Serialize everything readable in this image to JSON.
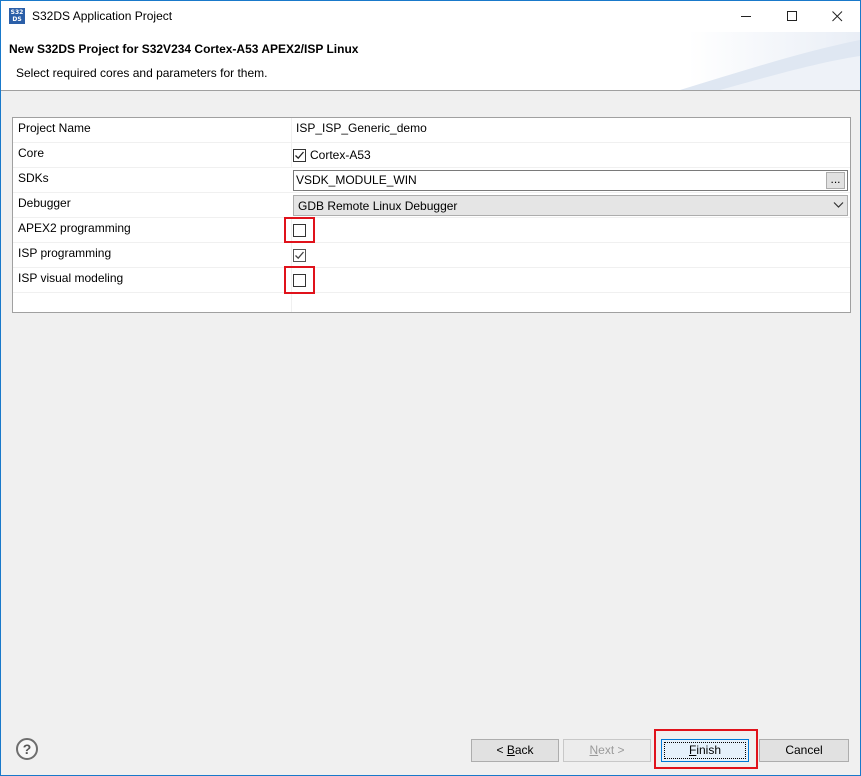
{
  "window": {
    "title": "S32DS Application Project",
    "app_icon_text_top": "S32",
    "app_icon_text_bottom": "DS"
  },
  "banner": {
    "title": "New S32DS Project for S32V234 Cortex-A53 APEX2/ISP Linux",
    "description": "Select required cores and parameters for them."
  },
  "properties": {
    "project_name": {
      "label": "Project Name",
      "value": "ISP_ISP_Generic_demo"
    },
    "core": {
      "label": "Core",
      "option_label": "Cortex-A53",
      "checked": true
    },
    "sdks": {
      "label": "SDKs",
      "value": "VSDK_MODULE_WIN",
      "browse_label": "..."
    },
    "debugger": {
      "label": "Debugger",
      "selected": "GDB Remote Linux Debugger"
    },
    "apex2": {
      "label": "APEX2 programming",
      "checked": false
    },
    "isp": {
      "label": "ISP programming",
      "checked": true
    },
    "isp_visual": {
      "label": "ISP visual modeling",
      "checked": false
    }
  },
  "buttons": {
    "help": "?",
    "back_prefix": "< ",
    "back_mnemonic": "B",
    "back_rest": "ack",
    "next_mnemonic": "N",
    "next_rest": "ext >",
    "finish_mnemonic": "F",
    "finish_rest": "inish",
    "cancel": "Cancel"
  },
  "colors": {
    "highlight": "#e0121b",
    "window_border": "#1979ca",
    "finish_border": "#0078d7"
  }
}
